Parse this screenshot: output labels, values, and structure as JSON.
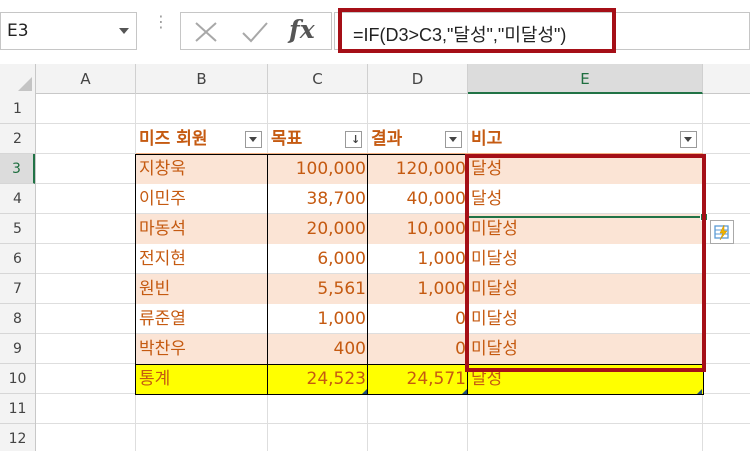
{
  "name_box": {
    "value": "E3"
  },
  "formula_bar": {
    "formula": "=IF(D3>C3,\"달성\",\"미달성\")",
    "cancel_icon": "close-icon",
    "enter_icon": "check-icon",
    "fx_label": "fx"
  },
  "columns": [
    "A",
    "B",
    "C",
    "D",
    "E"
  ],
  "rows": [
    "1",
    "2",
    "3",
    "4",
    "5",
    "6",
    "7",
    "8",
    "9",
    "10",
    "11",
    "12"
  ],
  "active_cell": {
    "column": "E",
    "row": "3"
  },
  "table": {
    "headers": [
      "미즈 회원",
      "목표",
      "결과",
      "비고"
    ],
    "rows": [
      {
        "name": "지창욱",
        "target": "100,000",
        "result": "120,000",
        "note": "달성"
      },
      {
        "name": "이민주",
        "target": "38,700",
        "result": "40,000",
        "note": "달성"
      },
      {
        "name": "마동석",
        "target": "20,000",
        "result": "10,000",
        "note": "미달성"
      },
      {
        "name": "전지현",
        "target": "6,000",
        "result": "1,000",
        "note": "미달성"
      },
      {
        "name": "원빈",
        "target": "5,561",
        "result": "1,000",
        "note": "미달성"
      },
      {
        "name": "류준열",
        "target": "1,000",
        "result": "0",
        "note": "미달성"
      },
      {
        "name": "박찬우",
        "target": "400",
        "result": "0",
        "note": "미달성"
      }
    ],
    "total": {
      "name": "통계",
      "target": "24,523",
      "result": "24,571",
      "note": "달성"
    }
  },
  "colors": {
    "highlight_border": "#a50f17",
    "table_text": "#c55a11",
    "band_fill": "#fbe4d5",
    "total_fill": "#ffff00",
    "excel_green": "#217346"
  },
  "icons": {
    "quick_analysis": "quick-analysis-icon",
    "filter": "filter-dropdown-icon",
    "sort": "sort-descending-icon"
  }
}
